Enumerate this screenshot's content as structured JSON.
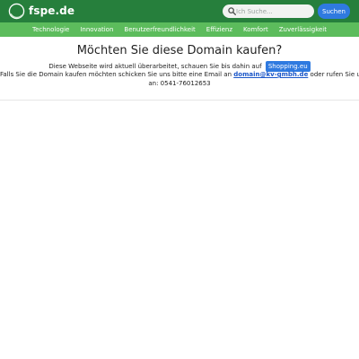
{
  "header": {
    "brand": "fspe.de",
    "search": {
      "placeholder": "Ich Suche...",
      "value": "",
      "button_label": "Suchen"
    },
    "logo_icon": "circle-logo-icon",
    "search_icon": "search-icon"
  },
  "nav": {
    "items": [
      {
        "label": "Technologie"
      },
      {
        "label": "Innovation"
      },
      {
        "label": "Benutzerfreundlichkeit"
      },
      {
        "label": "Effizienz"
      },
      {
        "label": "Komfort"
      },
      {
        "label": "Zuverlässigkeit"
      }
    ]
  },
  "main": {
    "title": "Möchten Sie diese Domain kaufen?",
    "line1_text": "Diese Webseite wird aktuell überarbeitet, schauen Sie bis dahin auf",
    "shop_badge": "Shopping.eu",
    "line2_prefix": "Falls Sie die Domain kaufen möchten schicken Sie uns bitte eine Email an",
    "email": "domain@kv-gmbh.de",
    "line2_suffix": "oder rufen Sie uns",
    "line3_text": "an: 0541-76012653"
  },
  "colors": {
    "header_bg": "#267f3c",
    "nav_bg": "#5cbc5c",
    "accent_blue": "#2f7ae0",
    "link_blue": "#1a56c8"
  }
}
